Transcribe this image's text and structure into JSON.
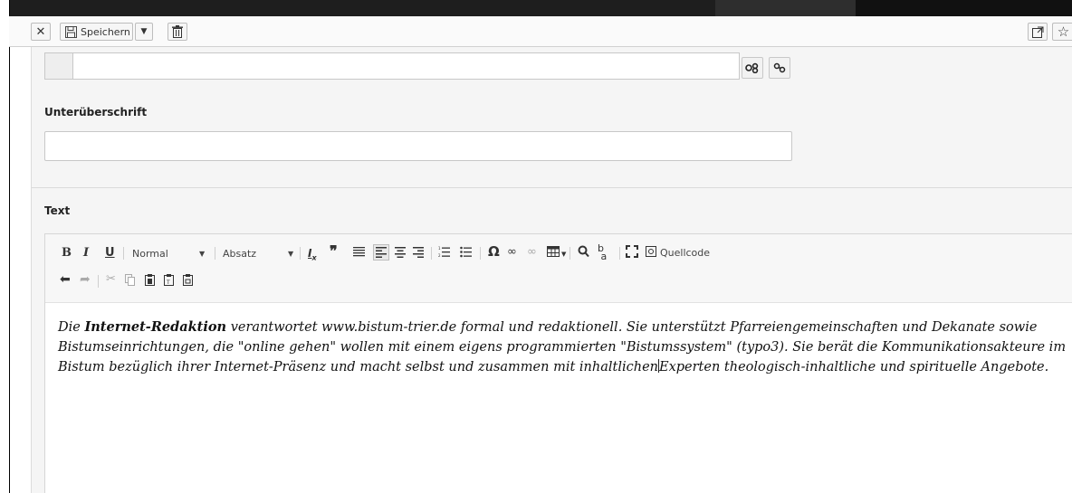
{
  "toolbar": {
    "close_icon": "close-icon",
    "save_label": "Speichern",
    "dropdown_icon": "caret-down-icon",
    "delete_icon": "trash-icon",
    "open_new_window_icon": "external-link-icon",
    "star_icon": "star-icon"
  },
  "link_field": {
    "value": "",
    "buttons": [
      "link-icon",
      "unlink-icon"
    ]
  },
  "subheading": {
    "label": "Unterüberschrift",
    "value": ""
  },
  "text_field": {
    "label": "Text",
    "format_style": "Normal",
    "format_paragraph": "Absatz",
    "source_label": "Quellcode",
    "content": {
      "part1": "Die ",
      "bold": "Internet-Redaktion",
      "part2": " verantwortet www.bistum-trier.de formal und redaktionell. Sie unterstützt Pfarreiengemeinschaften und Dekanate sowie Bistumseinrichtungen, die \"online gehen\" wollen mit einem eigens programmierten  \"Bistumssystem\" (typo3). Sie berät die Kommunikationsakteure im Bistum bezüglich ihrer Internet-Präsenz und macht selbst und zusammen mit inhaltlichen",
      "part3": "Experten theologisch-inhaltliche und spirituelle Angebote."
    }
  },
  "colors": {
    "toolbar_bg": "#fafafa",
    "content_bg": "#f5f5f5",
    "dark_bar": "#1e1e1e"
  }
}
